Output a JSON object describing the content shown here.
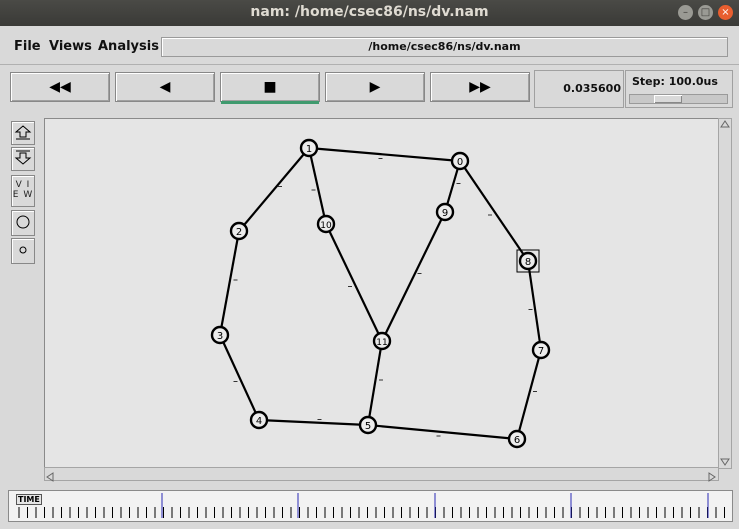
{
  "window": {
    "title": "nam: /home/csec86/ns/dv.nam"
  },
  "menu": {
    "file": "File",
    "views": "Views",
    "analysis": "Analysis"
  },
  "path": "/home/csec86/ns/dv.nam",
  "controls": {
    "rewind": "◀◀",
    "back": "◀",
    "stop": "■",
    "play": "▶",
    "fast_forward": "▶▶",
    "time": "0.035600",
    "step_label": "Step: 100.0us",
    "step_slider_fraction": 0.35
  },
  "sidebar": {
    "zoom_in_icon": "zoom-in-icon",
    "zoom_out_icon": "zoom-out-icon",
    "view_label_top": "V I",
    "view_label_bottom": "E W",
    "big_node_icon": "circle-large-icon",
    "small_node_icon": "circle-small-icon"
  },
  "topology": {
    "nodes": [
      {
        "id": "0",
        "label": "0"
      },
      {
        "id": "1",
        "label": "1"
      },
      {
        "id": "2",
        "label": "2"
      },
      {
        "id": "3",
        "label": "3"
      },
      {
        "id": "4",
        "label": "4"
      },
      {
        "id": "5",
        "label": "5"
      },
      {
        "id": "6",
        "label": "6"
      },
      {
        "id": "7",
        "label": "7"
      },
      {
        "id": "8",
        "label": "8"
      },
      {
        "id": "9",
        "label": "9"
      },
      {
        "id": "10",
        "label": "10"
      },
      {
        "id": "11",
        "label": "11"
      }
    ],
    "links": [
      [
        "1",
        "0"
      ],
      [
        "1",
        "2"
      ],
      [
        "1",
        "10"
      ],
      [
        "0",
        "9"
      ],
      [
        "0",
        "8"
      ],
      [
        "2",
        "3"
      ],
      [
        "3",
        "4"
      ],
      [
        "4",
        "5"
      ],
      [
        "5",
        "6"
      ],
      [
        "5",
        "11"
      ],
      [
        "10",
        "11"
      ],
      [
        "9",
        "11"
      ],
      [
        "8",
        "7"
      ],
      [
        "7",
        "6"
      ]
    ],
    "selected_node": "8"
  },
  "timeline": {
    "label": "TIME"
  }
}
